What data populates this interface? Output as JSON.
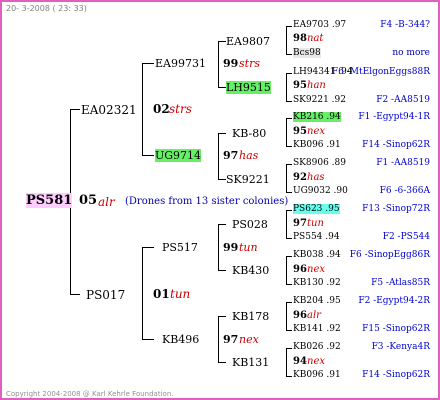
{
  "header": "20- 3-2008 ( 23: 33)",
  "footer": "Copyright 2004-2008 @ Karl Kehrle Foundation.",
  "root": {
    "name": "PS581",
    "num": "05",
    "gen": "alr",
    "note": "(Drones from 13 sister colonies)"
  },
  "gen1": [
    {
      "name": "EA02321",
      "num": "02",
      "gen": "strs"
    },
    {
      "name": "PS017",
      "num": "01",
      "gen": "tun"
    }
  ],
  "gen2": [
    {
      "name": "EA99731",
      "num": "99",
      "gen": "strs"
    },
    {
      "name": "UG9714",
      "num": "97",
      "gen": "has"
    },
    {
      "name": "PS517",
      "num": "99",
      "gen": "tun"
    },
    {
      "name": "KB496",
      "num": "97",
      "gen": "nex"
    }
  ],
  "gen3": [
    {
      "name": "EA9807",
      "num": "98",
      "gen": "nat"
    },
    {
      "name": "LH9515",
      "num": "95",
      "gen": "han"
    },
    {
      "name": "KB-80",
      "num": "95",
      "gen": "nex"
    },
    {
      "name": "SK9221",
      "num": "92",
      "gen": "has"
    },
    {
      "name": "PS028",
      "num": "97",
      "gen": "tun"
    },
    {
      "name": "KB430",
      "num": "96",
      "gen": "nex"
    },
    {
      "name": "KB178",
      "num": "96",
      "gen": "alr"
    },
    {
      "name": "KB131",
      "num": "94",
      "gen": "nex"
    }
  ],
  "gen4": [
    {
      "name": "EA9703 .97",
      "origin": "F4 -B-344?"
    },
    {
      "name": "Bcs98",
      "origin": "no more"
    },
    {
      "name": "LH94341 .94",
      "origin": "F6 -MtElgonEggs88R"
    },
    {
      "name": "SK9221 .92",
      "origin": "F2 -AA8519"
    },
    {
      "name": "KB216 .94",
      "origin": "F1 -Egypt94-1R"
    },
    {
      "name": "KB096 .91",
      "origin": "F14 -Sinop62R"
    },
    {
      "name": "SK8906 .89",
      "origin": "F1 -AA8519"
    },
    {
      "name": "UG9032 .90",
      "origin": "F6 -6-366A"
    },
    {
      "name": "PS623 .95",
      "origin": "F13 -Sinop72R"
    },
    {
      "name": "PS554 .94",
      "origin": "F2 -PS544"
    },
    {
      "name": "KB038 .94",
      "origin": "F6 -SinopEgg86R"
    },
    {
      "name": "KB130 .92",
      "origin": "F5 -Atlas85R"
    },
    {
      "name": "KB204 .95",
      "origin": "F2 -Egypt94-2R"
    },
    {
      "name": "KB141 .92",
      "origin": "F15 -Sinop62R"
    },
    {
      "name": "KB026 .92",
      "origin": "F3 -Kenya4R"
    },
    {
      "name": "KB096 .91",
      "origin": "F14 -Sinop62R"
    }
  ]
}
